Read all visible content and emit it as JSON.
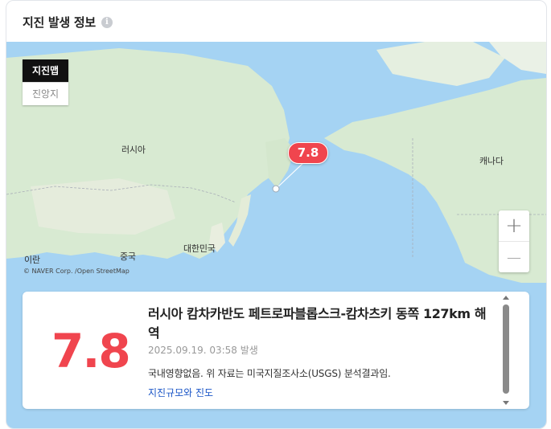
{
  "header": {
    "title": "지진 발생 정보",
    "info_icon": "info-icon"
  },
  "map": {
    "toggle": {
      "active": "지진맵",
      "inactive": "진앙지"
    },
    "labels": {
      "russia": "러시아",
      "canada": "캐나다",
      "china": "중국",
      "korea": "대한민국",
      "iran": "이란"
    },
    "copyright": "© NAVER Corp. /Open StreetMap",
    "zoom_in": "+",
    "zoom_out": "—",
    "marker_badge": "7.8",
    "colors": {
      "ocean": "#a5d3f3",
      "land": "#d8ead2",
      "accent": "#f0454e"
    }
  },
  "quake": {
    "magnitude": "7.8",
    "location": "러시아 캄차카반도 페트로파블롭스크-캄차츠키 동쪽 127km 해역",
    "time": "2025.09.19. 03:58 발생",
    "note": "국내영향없음. 위 자료는 미국지질조사소(USGS) 분석결과임.",
    "link": "지진규모와 진도"
  }
}
